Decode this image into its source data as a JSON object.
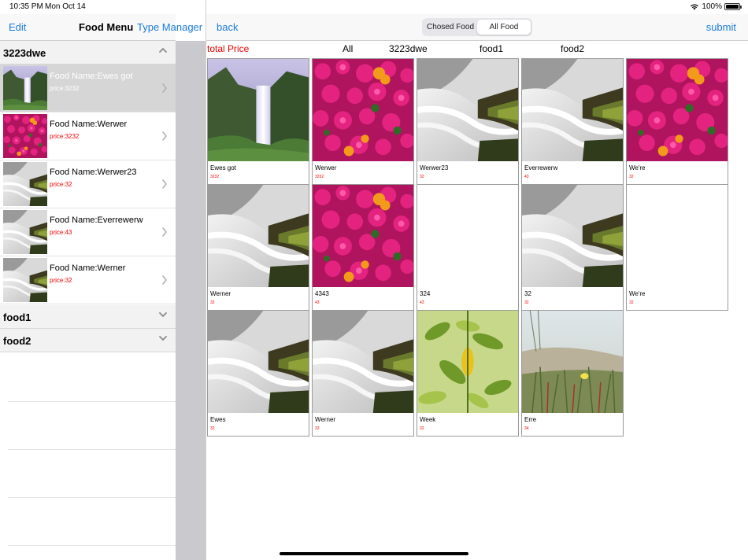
{
  "status": {
    "time": "10:35 PM",
    "date": "Mon Oct 14",
    "battery": "100%"
  },
  "left_nav": {
    "edit": "Edit",
    "title": "Food Menu",
    "type_manager": "Type Manager"
  },
  "sections": [
    {
      "title": "3223dwe",
      "chevron": "chevron-up-icon"
    },
    {
      "title": "food1",
      "chevron": "chevron-down-icon"
    },
    {
      "title": "food2",
      "chevron": "chevron-down-icon"
    }
  ],
  "rows": [
    {
      "name": "Food Name:Ewes got",
      "price": "price:3232",
      "image": "waterfall",
      "selected": true
    },
    {
      "name": "Food Name:Werwer",
      "price": "price:3232",
      "image": "flowers",
      "selected": false
    },
    {
      "name": "Food Name:Werwer23",
      "price": "price:32",
      "image": "stream",
      "selected": false
    },
    {
      "name": "Food Name:Everrewerw",
      "price": "price:43",
      "image": "stream",
      "selected": false
    },
    {
      "name": "Food Name:Werner",
      "price": "price:32",
      "image": "stream",
      "selected": false
    }
  ],
  "right_nav": {
    "back": "back",
    "submit": "submit",
    "segments": [
      "Chosed Food",
      "All Food"
    ],
    "active_segment": 1
  },
  "filter_bar": {
    "total_price": "total Price",
    "filters": [
      "All",
      "3223dwe",
      "food1",
      "food2"
    ]
  },
  "cards": [
    {
      "name": "Ewes got",
      "price": "3232",
      "image": "waterfall"
    },
    {
      "name": "Werwer",
      "price": "3232",
      "image": "flowers"
    },
    {
      "name": "Werwer23",
      "price": "32",
      "image": "stream"
    },
    {
      "name": "Everrewerw",
      "price": "43",
      "image": "stream"
    },
    {
      "name": "We're",
      "price": "32",
      "image": "flowers"
    },
    {
      "name": "Werner",
      "price": "32",
      "image": "stream"
    },
    {
      "name": "4343",
      "price": "43",
      "image": "flowers"
    },
    {
      "name": "324",
      "price": "43",
      "image": "none"
    },
    {
      "name": "32",
      "price": "32",
      "image": "stream"
    },
    {
      "name": "We're",
      "price": "32",
      "image": "none"
    },
    {
      "name": "Ewes",
      "price": "32",
      "image": "stream"
    },
    {
      "name": "Werner",
      "price": "32",
      "image": "stream"
    },
    {
      "name": "Week",
      "price": "32",
      "image": "leaves"
    },
    {
      "name": "Erre",
      "price": "34",
      "image": "grass"
    }
  ],
  "colors": {
    "accent": "#1a7ad9",
    "price": "#ee0000",
    "selected_row": "#d6d6d6",
    "strip": "#c9c9ce"
  }
}
